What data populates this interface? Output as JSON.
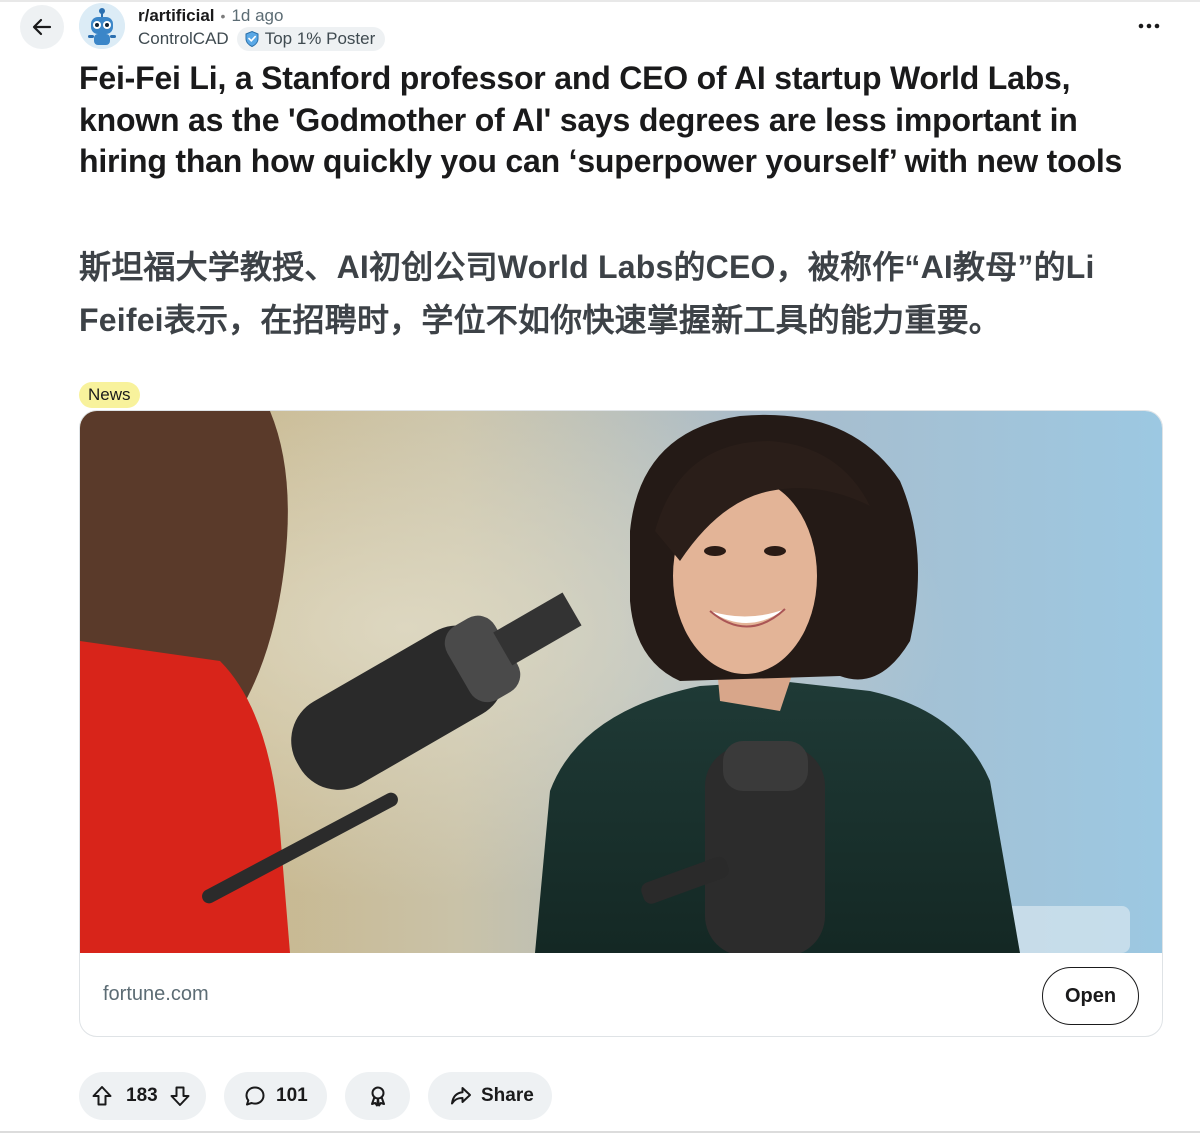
{
  "header": {
    "subreddit": "r/artificial",
    "separator": "•",
    "time_ago": "1d ago",
    "author": "ControlCAD",
    "author_flair": "Top 1% Poster"
  },
  "post": {
    "title": "Fei-Fei Li, a Stanford professor and CEO of AI startup World Labs, known as the 'Godmother of AI' says degrees are less important in hiring than how quickly you can ‘superpower yourself’ with new tools",
    "subtitle": "斯坦福大学教授、AI初创公司World Labs的CEO，被称作“AI教母”的Li Feifei表示，在招聘时，学位不如你快速掌握新工具的能力重要。",
    "post_flair": "News",
    "post_flair_color": "#f8f29c"
  },
  "link_card": {
    "domain": "fortune.com",
    "open_label": "Open"
  },
  "actions": {
    "upvotes": "183",
    "comments": "101",
    "share_label": "Share"
  },
  "icons": {
    "back": "arrow-left-icon",
    "more": "more-horizontal-icon",
    "upvote": "arrow-up-icon",
    "downvote": "arrow-down-icon",
    "comment": "speech-bubble-icon",
    "award": "award-ribbon-icon",
    "share": "share-arrow-icon",
    "flair": "shield-badge-icon"
  }
}
